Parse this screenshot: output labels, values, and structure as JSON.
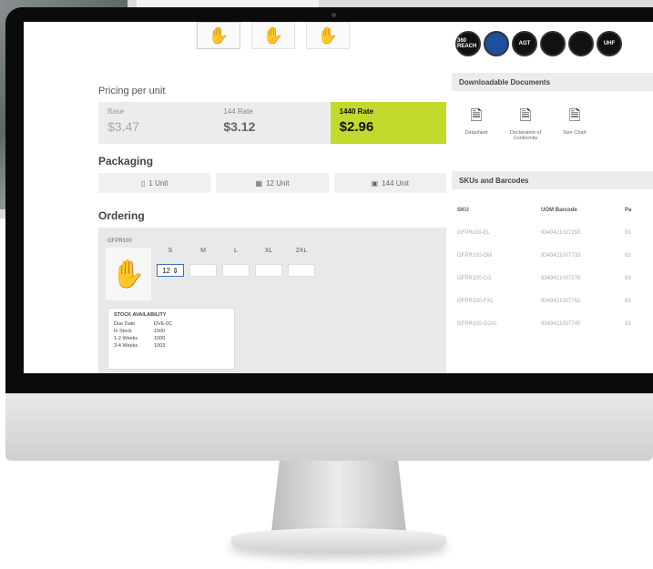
{
  "thumbnails": [
    "glove-view-1",
    "glove-view-2",
    "glove-view-3"
  ],
  "badges": [
    "360 REACH",
    "",
    "AGT",
    "",
    "",
    "UHF"
  ],
  "pricing": {
    "section_label": "Pricing per unit",
    "cols": [
      {
        "label": "Base",
        "value": "$3.47"
      },
      {
        "label": "144 Rate",
        "value": "$3.12"
      },
      {
        "label": "1440 Rate",
        "value": "$2.96"
      }
    ],
    "highlight_color": "#c3d92b"
  },
  "packaging": {
    "title": "Packaging",
    "items": [
      "1 Unit",
      "12 Unit",
      "144 Unit"
    ]
  },
  "ordering": {
    "title": "Ordering",
    "sku_label": "GFPR100",
    "sizes": [
      "S",
      "M",
      "L",
      "XL",
      "2XL"
    ],
    "qty_active": "12",
    "stock": {
      "title": "STOCK AVAILABILITY",
      "rows": [
        {
          "k": "Due Date",
          "v": "DVE-0C"
        },
        {
          "k": "In Stock",
          "v": "1500"
        },
        {
          "k": "1-2 Weeks",
          "v": "1000"
        },
        {
          "k": "3-4 Weeks",
          "v": "1003"
        }
      ]
    }
  },
  "documents": {
    "title": "Downloadable Documents",
    "items": [
      "Datasheet",
      "Declaration of Conformity",
      "Size Chart"
    ]
  },
  "skus": {
    "title": "SKUs and Barcodes",
    "headers": [
      "SKU",
      "UOM Barcode",
      "Pa"
    ],
    "rows": [
      [
        "GFPR100-EL",
        "9349421007293",
        "93"
      ],
      [
        "GFPR100-DM",
        "9349421007733",
        "93"
      ],
      [
        "GFPR100-CG",
        "9349421007278",
        "93"
      ],
      [
        "GFPR100-FXL",
        "9349421007762",
        "93"
      ],
      [
        "GFPR100-G2XL",
        "9349421007740",
        "93"
      ]
    ]
  }
}
